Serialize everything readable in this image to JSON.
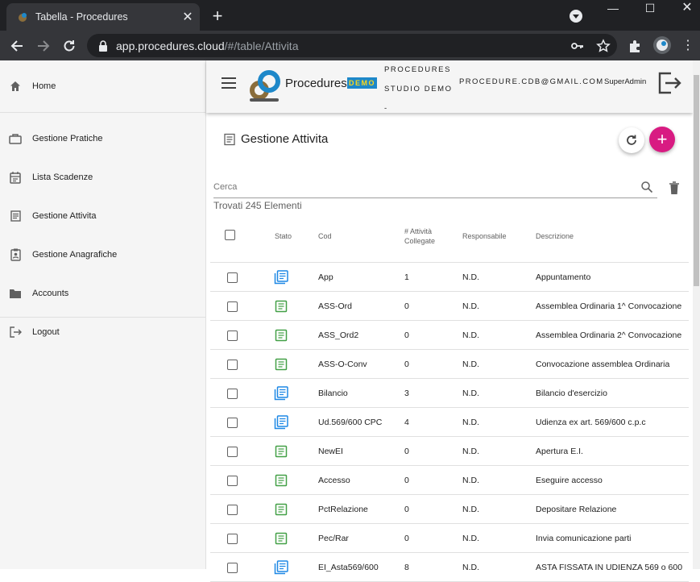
{
  "browser": {
    "tab_title": "Tabella - Procedures",
    "url_host": "app.procedures.cloud",
    "url_path": "/#/table/Attivita"
  },
  "sidebar": {
    "items": [
      {
        "label": "Home",
        "icon": "home-icon"
      },
      {
        "label": "Gestione Pratiche",
        "icon": "briefcase-icon"
      },
      {
        "label": "Lista Scadenze",
        "icon": "calendar-icon"
      },
      {
        "label": "Gestione Attivita",
        "icon": "list-icon"
      },
      {
        "label": "Gestione Anagrafiche",
        "icon": "contact-clipboard-icon"
      },
      {
        "label": "Accounts",
        "icon": "folder-icon"
      },
      {
        "label": "Logout",
        "icon": "logout-icon"
      }
    ]
  },
  "appbar": {
    "brand": "Procedures",
    "demo": "DEMO",
    "studio": "PROCEDURES STUDIO DEMO -",
    "email": "PROCEDURE.CDB@GMAIL.COM",
    "role": "SuperAdmin"
  },
  "page": {
    "title": "Gestione Attivita",
    "search_placeholder": "Cerca",
    "found": "Trovati 245 Elementi"
  },
  "table": {
    "headers": {
      "stato": "Stato",
      "cod": "Cod",
      "collegate": "# Attività Collegate",
      "responsabile": "Responsabile",
      "descrizione": "Descrizione"
    },
    "rows": [
      {
        "stato": "multi",
        "cod": "App",
        "collegate": "1",
        "responsabile": "N.D.",
        "descrizione": "Appuntamento"
      },
      {
        "stato": "single",
        "cod": "ASS-Ord",
        "collegate": "0",
        "responsabile": "N.D.",
        "descrizione": "Assemblea Ordinaria 1^ Convocazione"
      },
      {
        "stato": "single",
        "cod": "ASS_Ord2",
        "collegate": "0",
        "responsabile": "N.D.",
        "descrizione": "Assemblea Ordinaria 2^ Convocazione"
      },
      {
        "stato": "single",
        "cod": "ASS-O-Conv",
        "collegate": "0",
        "responsabile": "N.D.",
        "descrizione": "Convocazione assemblea Ordinaria"
      },
      {
        "stato": "multi",
        "cod": "Bilancio",
        "collegate": "3",
        "responsabile": "N.D.",
        "descrizione": "Bilancio d'esercizio"
      },
      {
        "stato": "multi",
        "cod": "Ud.569/600 CPC",
        "collegate": "4",
        "responsabile": "N.D.",
        "descrizione": "Udienza ex art. 569/600 c.p.c"
      },
      {
        "stato": "single",
        "cod": "NewEI",
        "collegate": "0",
        "responsabile": "N.D.",
        "descrizione": "Apertura E.I."
      },
      {
        "stato": "single",
        "cod": "Accesso",
        "collegate": "0",
        "responsabile": "N.D.",
        "descrizione": "Eseguire accesso"
      },
      {
        "stato": "single",
        "cod": "PctRelazione",
        "collegate": "0",
        "responsabile": "N.D.",
        "descrizione": "Depositare Relazione"
      },
      {
        "stato": "single",
        "cod": "Pec/Rar",
        "collegate": "0",
        "responsabile": "N.D.",
        "descrizione": "Invia comunicazione parti"
      },
      {
        "stato": "multi",
        "cod": "EI_Asta569/600",
        "collegate": "8",
        "responsabile": "N.D.",
        "descrizione": "ASTA FISSATA IN UDIENZA 569 o 600"
      }
    ]
  },
  "colors": {
    "accent": "#d81b82",
    "status_single": "#43a047",
    "status_multi": "#1e88e5"
  }
}
